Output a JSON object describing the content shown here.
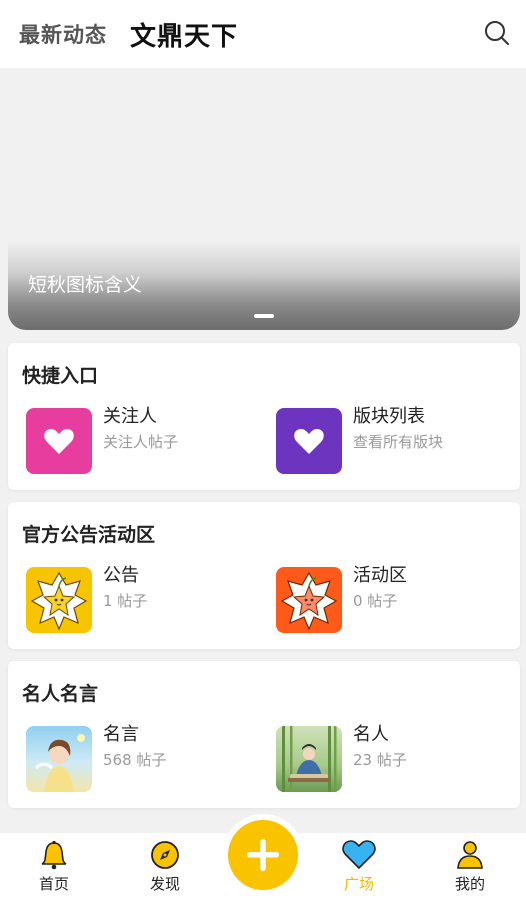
{
  "header": {
    "tab_latest": "最新动态",
    "tab_main": "文鼎天下",
    "search_icon": "search-icon"
  },
  "banner": {
    "caption": "短秋图标含义"
  },
  "quick_entry": {
    "title": "快捷入口",
    "items": [
      {
        "name": "关注人",
        "sub": "关注人帖子",
        "icon": "heart-icon",
        "color": "#e63d9e"
      },
      {
        "name": "版块列表",
        "sub": "查看所有版块",
        "icon": "heart-icon",
        "color": "#6d35bf"
      }
    ]
  },
  "official": {
    "title": "官方公告活动区",
    "items": [
      {
        "name": "公告",
        "sub": "1 帖子",
        "icon": "star-maple-icon",
        "color": "#f7c400"
      },
      {
        "name": "活动区",
        "sub": "0 帖子",
        "icon": "star-maple-icon",
        "color": "#ff5a1a"
      }
    ]
  },
  "quotes": {
    "title": "名人名言",
    "items": [
      {
        "name": "名言",
        "sub": "568 帖子",
        "icon": "girl-illustration"
      },
      {
        "name": "名人",
        "sub": "23 帖子",
        "icon": "scholar-illustration"
      }
    ]
  },
  "bottom_nav": {
    "items": [
      {
        "label": "首页",
        "icon": "bell-icon"
      },
      {
        "label": "发现",
        "icon": "compass-icon"
      },
      {
        "label": "广场",
        "icon": "heart-icon",
        "active": true
      },
      {
        "label": "我的",
        "icon": "person-icon"
      }
    ],
    "fab_icon": "plus-icon",
    "accent": "#f9c300"
  }
}
